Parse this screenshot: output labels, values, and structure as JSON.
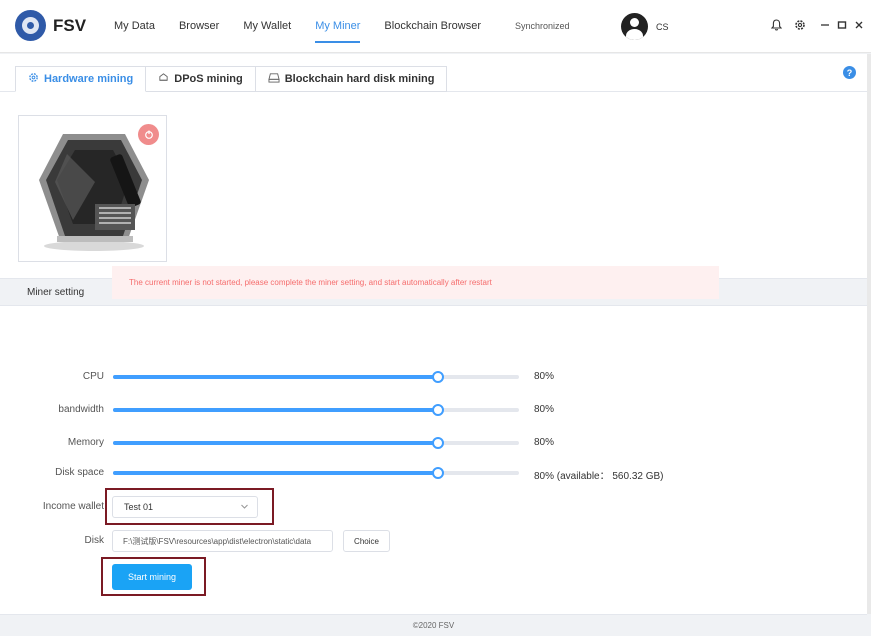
{
  "app": {
    "name": "FSV"
  },
  "nav": {
    "items": [
      {
        "label": "My Data"
      },
      {
        "label": "Browser"
      },
      {
        "label": "My Wallet"
      },
      {
        "label": "My Miner"
      },
      {
        "label": "Blockchain Browser"
      }
    ],
    "active": "My Miner"
  },
  "status": {
    "sync": "Synchronized"
  },
  "user": {
    "name": "CS"
  },
  "tabs": [
    {
      "label": "Hardware mining",
      "icon": "gear-icon",
      "active": true
    },
    {
      "label": "DPoS mining",
      "icon": "stack-icon",
      "active": false
    },
    {
      "label": "Blockchain hard disk mining",
      "icon": "hard-disk-icon",
      "active": false
    }
  ],
  "section": {
    "title": "Miner setting"
  },
  "alert": {
    "text": "The current miner is not started, please complete the miner setting, and start automatically after restart"
  },
  "sliders": [
    {
      "label": "CPU",
      "value": 80,
      "display": "80%"
    },
    {
      "label": "bandwidth",
      "value": 80,
      "display": "80%"
    },
    {
      "label": "Memory",
      "value": 80,
      "display": "80%"
    },
    {
      "label": "Disk space",
      "value": 80,
      "display": "80%  (available： 560.32 GB)"
    }
  ],
  "form": {
    "income_wallet_label": "Income wallet",
    "income_wallet_value": "Test 01",
    "disk_label": "Disk",
    "disk_value": "F:\\测试版\\FSV\\resources\\app\\dist\\electron\\static\\data",
    "choice_label": "Choice",
    "start_label": "Start mining"
  },
  "footer": {
    "text": "©2020 FSV"
  },
  "colors": {
    "accent": "#409eff",
    "alert_text": "#f56c6c",
    "alert_bg": "#fef0f0",
    "start_button": "#1aa3f5",
    "highlight_border": "#7b1a24"
  }
}
